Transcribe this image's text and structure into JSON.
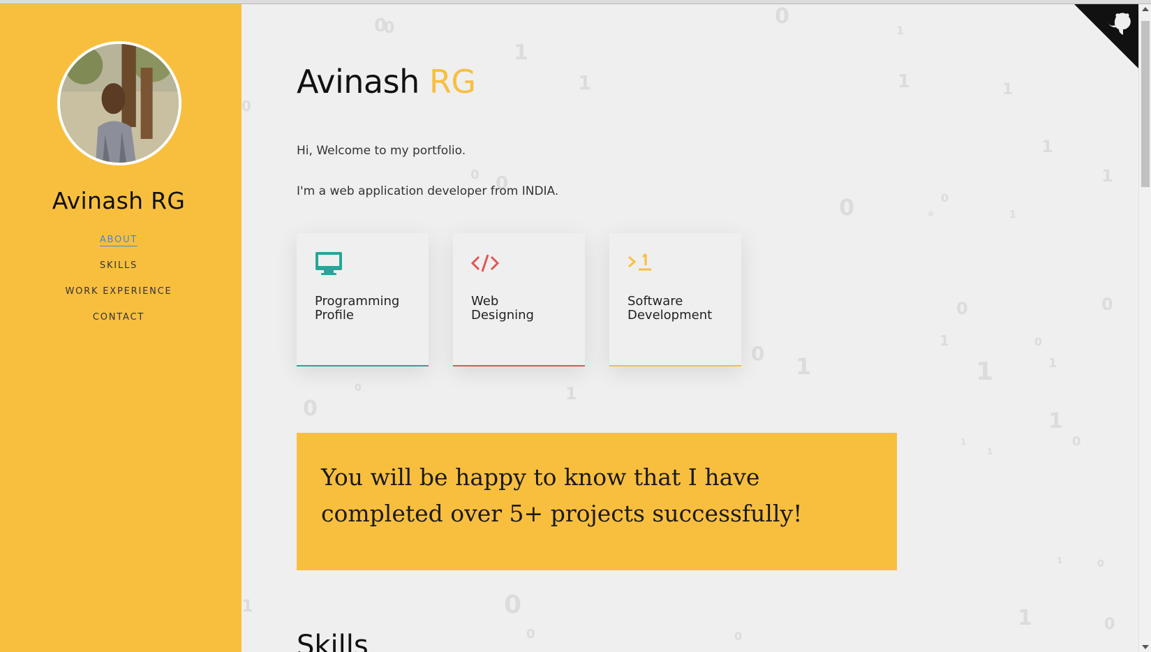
{
  "sidebar": {
    "name": "Avinash RG",
    "nav": [
      {
        "label": "ABOUT",
        "active": true
      },
      {
        "label": "SKILLS",
        "active": false
      },
      {
        "label": "WORK EXPERIENCE",
        "active": false
      },
      {
        "label": "CONTACT",
        "active": false
      }
    ]
  },
  "main": {
    "title_first": "Avinash",
    "title_accent": "RG",
    "intro_line_1": "Hi, Welcome to my portfolio.",
    "intro_line_2": "I'm a web application developer from INDIA.",
    "cards": [
      {
        "icon": "monitor-icon",
        "line1": "Programming",
        "line2": "Profile",
        "accent": "#26a69a"
      },
      {
        "icon": "code-icon",
        "line1": "Web",
        "line2": "Designing",
        "accent": "#e05555"
      },
      {
        "icon": "terminal-icon",
        "line1": "Software",
        "line2": "Development",
        "accent": "#f8bf3f"
      }
    ],
    "banner_text": "You will be happy to know that I have completed over 5+ projects successfully!",
    "next_section_heading": "Skills"
  },
  "corner_icon": "github-octocat-icon",
  "colors": {
    "sidebar_bg": "#f8bf3f",
    "main_bg": "#efefef",
    "accent_yellow": "#f8bf3f",
    "accent_teal": "#26a69a",
    "accent_red": "#e05555",
    "nav_active": "#4a86c8"
  }
}
